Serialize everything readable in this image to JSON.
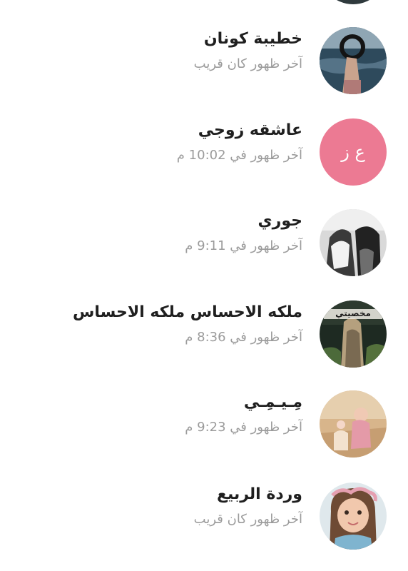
{
  "contacts": [
    {
      "name": "خطيبة كونان",
      "status": "آخر ظهور كان قريب"
    },
    {
      "name": "عاشقه زوجي",
      "status": "آخر ظهور في 10:02 م",
      "initials": "ع ز",
      "avatar_color": "#ec7a93"
    },
    {
      "name": "جوري",
      "status": "آخر ظهور في 9:11 م"
    },
    {
      "name": "ملكه الاحساس ملكه الاحساس",
      "status": "آخر ظهور في 8:36 م",
      "avatar_text": "مخصيتي"
    },
    {
      "name": "مِـيـمِـي",
      "status": "آخر ظهور في 9:23 م"
    },
    {
      "name": "وردة الربيع",
      "status": "آخر ظهور كان قريب"
    }
  ]
}
